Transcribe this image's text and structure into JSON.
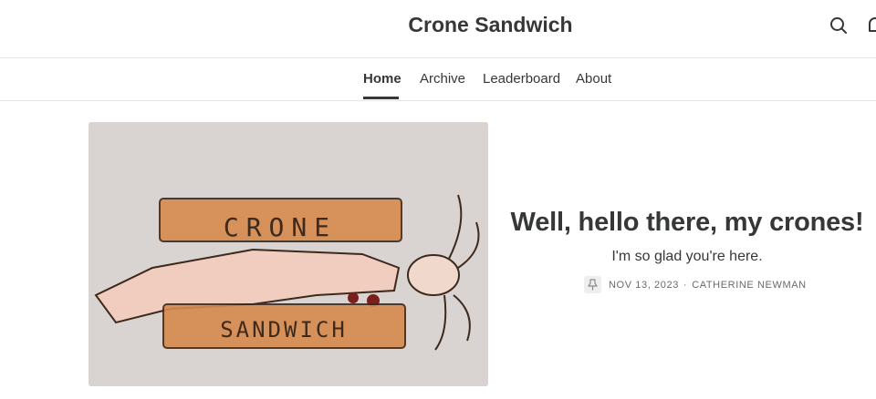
{
  "header": {
    "title": "Crone Sandwich",
    "search_icon": "search-icon",
    "notification_icon": "bell-icon"
  },
  "nav": {
    "tabs": [
      {
        "label": "Home",
        "active": true
      },
      {
        "label": "Archive"
      },
      {
        "label": "Leaderboard"
      },
      {
        "label": "About"
      }
    ]
  },
  "post": {
    "title": "Well, hello there, my crones!",
    "subtitle": "I'm so glad you're here.",
    "pin_icon": "pin-icon",
    "date": "NOV 13, 2023",
    "separator": "·",
    "author": "CATHERINE NEWMAN",
    "image": {
      "top_text": "CRONE",
      "bottom_text": "SANDWICH"
    }
  },
  "colors": {
    "text": "#363737",
    "muted": "#6b6b6b",
    "divider": "#e6e6e6",
    "bread": "#d68a4e"
  }
}
